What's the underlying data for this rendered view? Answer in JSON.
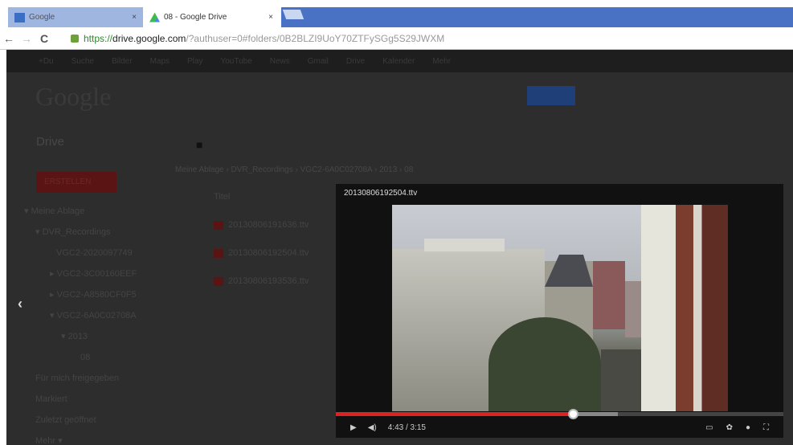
{
  "browser": {
    "tabs": [
      {
        "label": "Google",
        "close": "×"
      },
      {
        "label": "08 - Google Drive",
        "close": "×"
      }
    ],
    "url": {
      "scheme": "https://",
      "host": "drive.google.com",
      "path": "/?authuser=0#folders/0B2BLZI9UoY70ZTFySGg5S29JWXM"
    },
    "nav": {
      "back": "←",
      "forward": "→",
      "reload": "C"
    }
  },
  "drive": {
    "logo": "Google",
    "title": "Drive",
    "create_label": "ERSTELLEN",
    "tree": [
      "▾ Meine Ablage",
      "▾ DVR_Recordings",
      "VGC2-2020097749",
      "▸ VGC2-3C00160EEF",
      "▸ VGC2-A8580CF0F5",
      "▾ VGC2-6A0C02708A",
      "▾ 2013",
      "08",
      "Für mich freigegeben",
      "Markiert",
      "Zuletzt geöffnet",
      "Mehr ▾"
    ],
    "breadcrumb": "Meine Ablage › DVR_Recordings › VGC2-6A0C02708A › 2013 › 08",
    "column_title": "Titel",
    "files": [
      "20130806191636.ttv",
      "20130806192504.ttv",
      "20130806193536.ttv"
    ]
  },
  "player": {
    "title": "20130806192504.ttv",
    "time": "4:43 / 3:15",
    "played_fraction": 0.53,
    "buffered_fraction": 0.63,
    "prev_arrow": "‹"
  }
}
